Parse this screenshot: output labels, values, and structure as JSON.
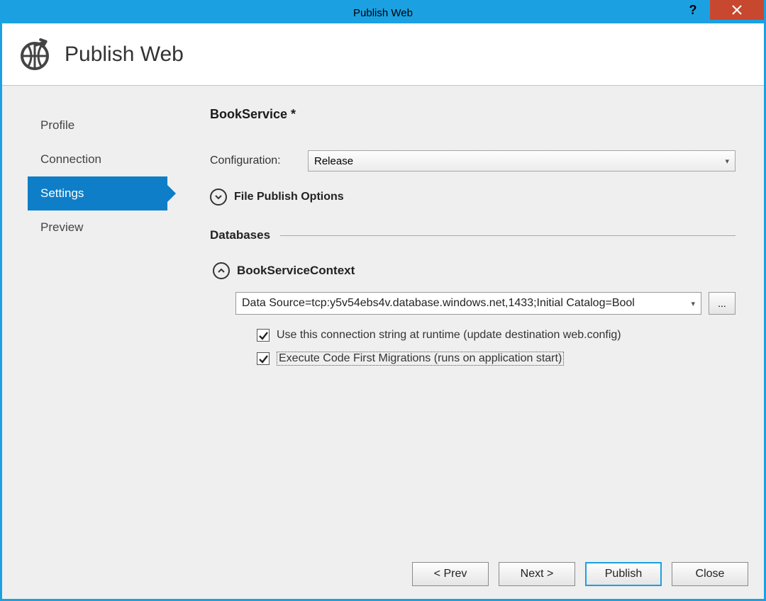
{
  "window": {
    "title": "Publish Web"
  },
  "header": {
    "title": "Publish Web"
  },
  "sidebar": {
    "items": [
      {
        "label": "Profile",
        "name": "nav-profile"
      },
      {
        "label": "Connection",
        "name": "nav-connection"
      },
      {
        "label": "Settings",
        "name": "nav-settings"
      },
      {
        "label": "Preview",
        "name": "nav-preview"
      }
    ],
    "active_index": 2
  },
  "main": {
    "profile_title": "BookService *",
    "configuration_label": "Configuration:",
    "configuration_value": "Release",
    "file_publish_options_label": "File Publish Options",
    "databases_label": "Databases",
    "db_context_label": "BookServiceContext",
    "connection_string": "Data Source=tcp:y5v54ebs4v.database.windows.net,1433;Initial Catalog=Bool",
    "browse_label": "...",
    "chk_use_conn": {
      "checked": true,
      "label": "Use this connection string at runtime (update destination web.config)"
    },
    "chk_migrations": {
      "checked": true,
      "label": "Execute Code First Migrations (runs on application start)"
    }
  },
  "footer": {
    "prev": "< Prev",
    "next": "Next >",
    "publish": "Publish",
    "close": "Close"
  }
}
